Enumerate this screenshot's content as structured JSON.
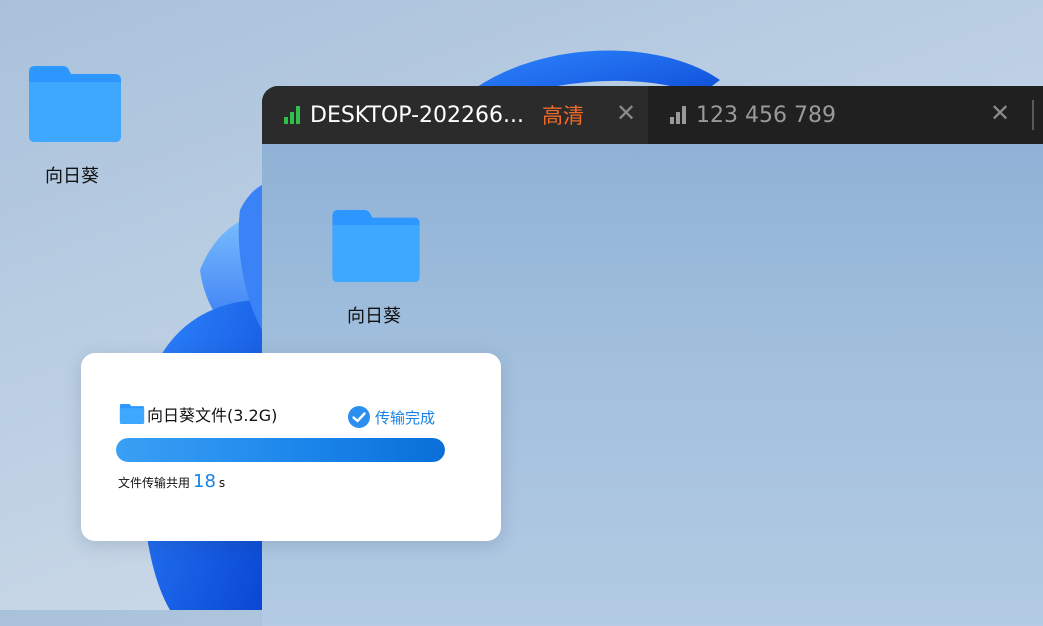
{
  "desktop": {
    "folder_label": "向日葵"
  },
  "remote_window": {
    "tabs": [
      {
        "title": "DESKTOP-202266...",
        "quality_label": "高清",
        "close": "✕",
        "signal_color": "#2fbf4a"
      },
      {
        "title": "123 456 789",
        "close": "✕",
        "signal_color": "#9a9a9a"
      }
    ],
    "folder_label": "向日葵"
  },
  "transfer": {
    "file_name": "向日葵文件(3.2G)",
    "status_label": "传输完成",
    "progress": 1.0,
    "duration_label": "文件传输共用",
    "duration_value": "18",
    "duration_unit": "s"
  },
  "colors": {
    "accent": "#1683e6",
    "hd_label": "#f06a2a",
    "folder": "#3ea8ff"
  }
}
